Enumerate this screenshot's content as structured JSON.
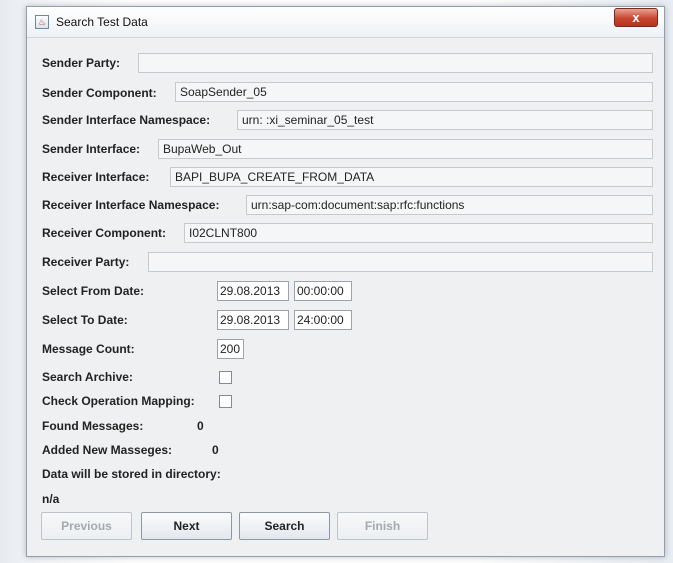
{
  "window": {
    "title": "Search Test Data",
    "close_label": "x"
  },
  "form": {
    "sender_party": {
      "label": "Sender Party:",
      "value": ""
    },
    "sender_component": {
      "label": "Sender Component:",
      "value": "SoapSender_05"
    },
    "sender_interface_namespace": {
      "label": "Sender Interface Namespace:",
      "value": "urn:          :xi_seminar_05_test"
    },
    "sender_interface": {
      "label": "Sender Interface:",
      "value": "BupaWeb_Out"
    },
    "receiver_interface": {
      "label": "Receiver Interface:",
      "value": "BAPI_BUPA_CREATE_FROM_DATA"
    },
    "receiver_interface_namespace": {
      "label": "Receiver Interface Namespace:",
      "value": "urn:sap-com:document:sap:rfc:functions"
    },
    "receiver_component": {
      "label": "Receiver Component:",
      "value": "I02CLNT800"
    },
    "receiver_party": {
      "label": "Receiver Party:",
      "value": ""
    },
    "select_from_date": {
      "label": "Select From Date:",
      "date": "29.08.2013",
      "time": "00:00:00"
    },
    "select_to_date": {
      "label": "Select To Date:",
      "date": "29.08.2013",
      "time": "24:00:00"
    },
    "message_count": {
      "label": "Message Count:",
      "value": "200"
    },
    "search_archive": {
      "label": "Search Archive:",
      "checked": false
    },
    "check_operation_mapping": {
      "label": "Check Operation Mapping:",
      "checked": false
    },
    "found_messages": {
      "label": "Found Messages:",
      "value": "0"
    },
    "added_new_messages": {
      "label": "Added New Masseges:",
      "value": "0"
    },
    "directory": {
      "label": "Data will be stored in directory:",
      "value": "n/a"
    }
  },
  "buttons": {
    "previous": "Previous",
    "next": "Next",
    "search": "Search",
    "finish": "Finish"
  }
}
